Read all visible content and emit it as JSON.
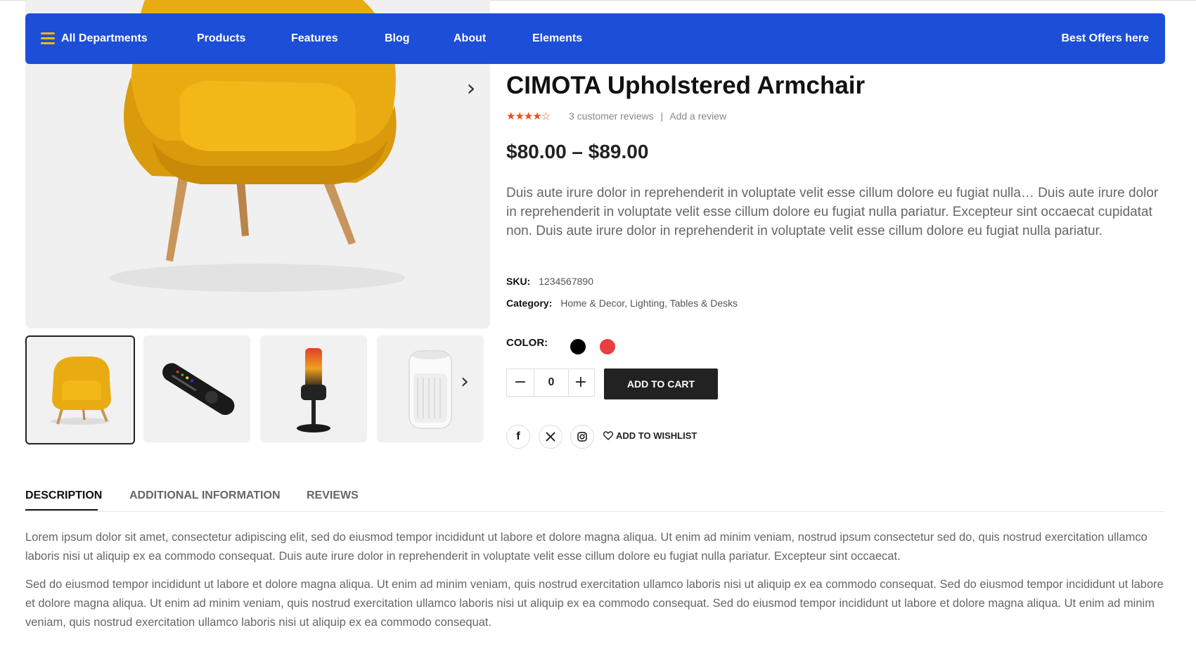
{
  "nav": {
    "departments": "All Departments",
    "items": [
      "Products",
      "Features",
      "Blog",
      "About",
      "Elements"
    ],
    "offers": "Best Offers here"
  },
  "product": {
    "title": "CIMOTA Upholstered Armchair",
    "rating_stars": "★★★★☆",
    "reviews_count": "3 customer reviews",
    "review_sep": "|",
    "add_review": "Add a review",
    "price": "$80.00 – $89.00",
    "short_description": "Duis aute irure dolor in reprehenderit in voluptate velit esse cillum dolore eu fugiat nulla… Duis aute irure dolor in reprehenderit in voluptate velit esse cillum dolore eu fugiat nulla pariatur. Excepteur sint occaecat cupidatat non. Duis aute irure dolor in reprehenderit in voluptate velit esse cillum dolore eu fugiat nulla pariatur.",
    "sku_label": "SKU:",
    "sku": "1234567890",
    "category_label": "Category:",
    "categories": "Home & Decor, Lighting, Tables & Desks",
    "color_label": "COLOR:",
    "colors": [
      "#000000",
      "#e84040"
    ],
    "quantity": "0",
    "add_to_cart": "ADD TO CART",
    "wishlist": "ADD TO WISHLIST",
    "social_icons": [
      "facebook-icon",
      "x-icon",
      "instagram-icon"
    ]
  },
  "gallery": {
    "thumbnails": [
      "armchair",
      "tv-remote",
      "microphone",
      "air-purifier"
    ]
  },
  "tabs": [
    "DESCRIPTION",
    "ADDITIONAL INFORMATION",
    "REVIEWS"
  ],
  "description": {
    "para1": "Lorem ipsum dolor sit amet, consectetur adipiscing elit, sed do eiusmod tempor incididunt ut labore et dolore magna aliqua. Ut enim ad minim veniam, nostrud ipsum consectetur sed do, quis nostrud exercitation ullamco laboris nisi ut aliquip ex ea commodo consequat. Duis aute irure dolor in reprehenderit in voluptate velit esse cillum dolore eu fugiat nulla pariatur. Excepteur sint occaecat.",
    "para2": "Sed do eiusmod tempor incididunt ut labore et dolore magna aliqua. Ut enim ad minim veniam, quis nostrud exercitation ullamco laboris nisi ut aliquip ex ea commodo consequat. Sed do eiusmod tempor incididunt ut labore et dolore magna aliqua. Ut enim ad minim veniam, quis nostrud exercitation ullamco laboris nisi ut aliquip ex ea commodo consequat. Sed do eiusmod tempor incididunt ut labore et dolore magna aliqua. Ut enim ad minim veniam, quis nostrud exercitation ullamco laboris nisi ut aliquip ex ea commodo consequat."
  }
}
